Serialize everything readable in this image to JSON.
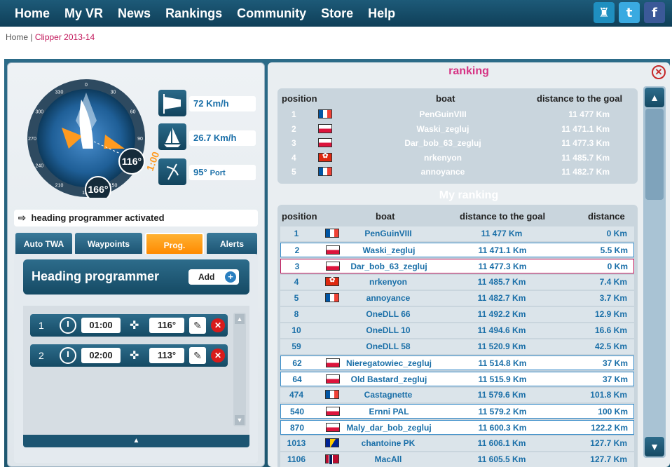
{
  "nav": {
    "items": [
      "Home",
      "My VR",
      "News",
      "Rankings",
      "Community",
      "Store",
      "Help"
    ],
    "social": [
      {
        "icon": "trophy-icon",
        "color": "#1f8fc0",
        "glyph": "♜"
      },
      {
        "icon": "twitter-icon",
        "color": "#3aaae1",
        "glyph": "t"
      },
      {
        "icon": "facebook-icon",
        "color": "#3b5998",
        "glyph": "f"
      }
    ]
  },
  "breadcrumb": {
    "home": "Home",
    "sep": "|",
    "current": "Clipper 2013-14"
  },
  "instruments": {
    "compass_heading": "116°",
    "compass_wind": "166°",
    "compass_ticks": [
      "0",
      "30",
      "60",
      "90",
      "120",
      "150",
      "180",
      "210",
      "240",
      "270",
      "300",
      "330"
    ],
    "wind_speed": "72 Km/h",
    "boat_speed": "26.7 Km/h",
    "twa": {
      "value": "95°",
      "side": "Port"
    },
    "timer": "1:00"
  },
  "status": {
    "message": "heading programmer activated"
  },
  "tabs": [
    "Auto TWA",
    "Waypoints",
    "Prog.",
    "Alerts"
  ],
  "programmer": {
    "title": "Heading programmer",
    "add_label": "Add",
    "rows": [
      {
        "num": "1",
        "time": "01:00",
        "heading": "116°"
      },
      {
        "num": "2",
        "time": "02:00",
        "heading": "113°"
      }
    ]
  },
  "ranking": {
    "title": "ranking",
    "headers": {
      "position": "position",
      "boat": "boat",
      "distance": "distance to the goal"
    },
    "rows": [
      {
        "pos": "1",
        "flag": "fr",
        "boat": "PenGuinVIII",
        "dist": "11 477 Km"
      },
      {
        "pos": "2",
        "flag": "pl",
        "boat": "Waski_zegluj",
        "dist": "11 471.1 Km"
      },
      {
        "pos": "3",
        "flag": "pl",
        "boat": "Dar_bob_63_zegluj",
        "dist": "11 477.3 Km"
      },
      {
        "pos": "4",
        "flag": "hk",
        "boat": "nrkenyon",
        "dist": "11 485.7 Km"
      },
      {
        "pos": "5",
        "flag": "fr",
        "boat": "annoyance",
        "dist": "11 482.7 Km"
      }
    ]
  },
  "my_ranking": {
    "title": "My ranking",
    "headers": {
      "position": "position",
      "boat": "boat",
      "distance": "distance to the goal",
      "gap": "distance"
    },
    "rows": [
      {
        "pos": "1",
        "flag": "fr",
        "boat": "PenGuinVIII",
        "dist": "11 477 Km",
        "gap": "0 Km",
        "style": ""
      },
      {
        "pos": "2",
        "flag": "pl",
        "boat": "Waski_zegluj",
        "dist": "11 471.1 Km",
        "gap": "5.5 Km",
        "style": "hl"
      },
      {
        "pos": "3",
        "flag": "pl",
        "boat": "Dar_bob_63_zegluj",
        "dist": "11 477.3 Km",
        "gap": "0 Km",
        "style": "me"
      },
      {
        "pos": "4",
        "flag": "hk",
        "boat": "nrkenyon",
        "dist": "11 485.7 Km",
        "gap": "7.4 Km",
        "style": ""
      },
      {
        "pos": "5",
        "flag": "fr",
        "boat": "annoyance",
        "dist": "11 482.7 Km",
        "gap": "3.7 Km",
        "style": ""
      },
      {
        "pos": "8",
        "flag": "",
        "boat": "OneDLL 66",
        "dist": "11 492.2 Km",
        "gap": "12.9 Km",
        "style": ""
      },
      {
        "pos": "10",
        "flag": "",
        "boat": "OneDLL 10",
        "dist": "11 494.6 Km",
        "gap": "16.6 Km",
        "style": ""
      },
      {
        "pos": "59",
        "flag": "",
        "boat": "OneDLL 58",
        "dist": "11 520.9 Km",
        "gap": "42.5 Km",
        "style": ""
      },
      {
        "pos": "62",
        "flag": "pl",
        "boat": "Nieregatowiec_zegluj",
        "dist": "11 514.8 Km",
        "gap": "37 Km",
        "style": "hl"
      },
      {
        "pos": "64",
        "flag": "pl",
        "boat": "Old Bastard_zegluj",
        "dist": "11 515.9 Km",
        "gap": "37 Km",
        "style": "hl"
      },
      {
        "pos": "474",
        "flag": "fr",
        "boat": "Castagnette",
        "dist": "11 579.6 Km",
        "gap": "101.8 Km",
        "style": ""
      },
      {
        "pos": "540",
        "flag": "pl",
        "boat": "Ernni PAL",
        "dist": "11 579.2 Km",
        "gap": "100 Km",
        "style": "hl"
      },
      {
        "pos": "870",
        "flag": "pl",
        "boat": "Maly_dar_bob_zegluj",
        "dist": "11 600.3 Km",
        "gap": "122.2 Km",
        "style": "hl"
      },
      {
        "pos": "1013",
        "flag": "ba",
        "boat": "chantoine PK",
        "dist": "11 606.1 Km",
        "gap": "127.7 Km",
        "style": ""
      },
      {
        "pos": "1106",
        "flag": "no",
        "boat": "MacAll",
        "dist": "11 605.5 Km",
        "gap": "127.7 Km",
        "style": ""
      }
    ]
  }
}
